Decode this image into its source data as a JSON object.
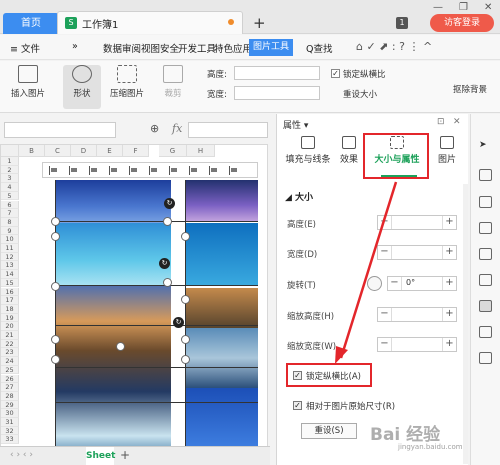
{
  "titlebar": {
    "home_tab": "首页",
    "doc_icon": "S",
    "doc_title": "工作簿1",
    "add_tab": "+",
    "badge": "1",
    "guest_login": "访客登录",
    "win_min": "—",
    "win_max": "❐",
    "win_close": "✕"
  },
  "menu": {
    "file": "≡ 文件",
    "more": "»",
    "items": [
      "数据",
      "审阅",
      "视图",
      "安全",
      "开发工具",
      "特色应用"
    ],
    "active": "图片工具",
    "search": "Q查找",
    "icons": "⌂ ✓ ⬈ : ? ⋮ ^"
  },
  "ribbon": {
    "insert_picture": "插入图片",
    "shape": "形状",
    "compress": "压缩图片",
    "crop": "裁剪",
    "height_label": "高度:",
    "width_label": "宽度:",
    "lock_ratio": "锁定纵横比",
    "reset_size": "重设大小",
    "remove_bg": "抠除背景"
  },
  "formula": {
    "fx": "fx",
    "zoom_icon": "⊕"
  },
  "sheet": {
    "columns": [
      "B",
      "C",
      "D",
      "E",
      "F",
      "G",
      "H"
    ],
    "rows": [
      "1",
      "2",
      "3",
      "4",
      "5",
      "6",
      "7",
      "8",
      "9",
      "10",
      "11",
      "12",
      "13",
      "14",
      "15",
      "16",
      "17",
      "18",
      "19",
      "20",
      "21",
      "22",
      "23",
      "24",
      "25",
      "26",
      "27",
      "28",
      "29",
      "30",
      "31",
      "32",
      "33"
    ],
    "tab_name": "Sheet"
  },
  "panel": {
    "title": "属性 ▾",
    "tabs": [
      "填充与线条",
      "效果",
      "大小与属性",
      "图片"
    ],
    "section": "◢ 大小",
    "rows": [
      {
        "label": "高度(E)",
        "value": ""
      },
      {
        "label": "宽度(D)",
        "value": ""
      },
      {
        "label": "旋转(T)",
        "value": "0°"
      },
      {
        "label": "缩放高度(H)",
        "value": ""
      },
      {
        "label": "缩放宽度(W)",
        "value": ""
      }
    ],
    "lock_ratio": "锁定纵横比(A)",
    "relative_size": "相对于图片原始尺寸(R)",
    "reset": "重设(S)",
    "checked": "✓"
  },
  "watermark": {
    "brand": "Bai 经验",
    "sub": "jingyan.baidu.com"
  },
  "colors": {
    "accent": "#3c8df0",
    "highlight_red": "#e3262b",
    "green": "#1da15a"
  }
}
